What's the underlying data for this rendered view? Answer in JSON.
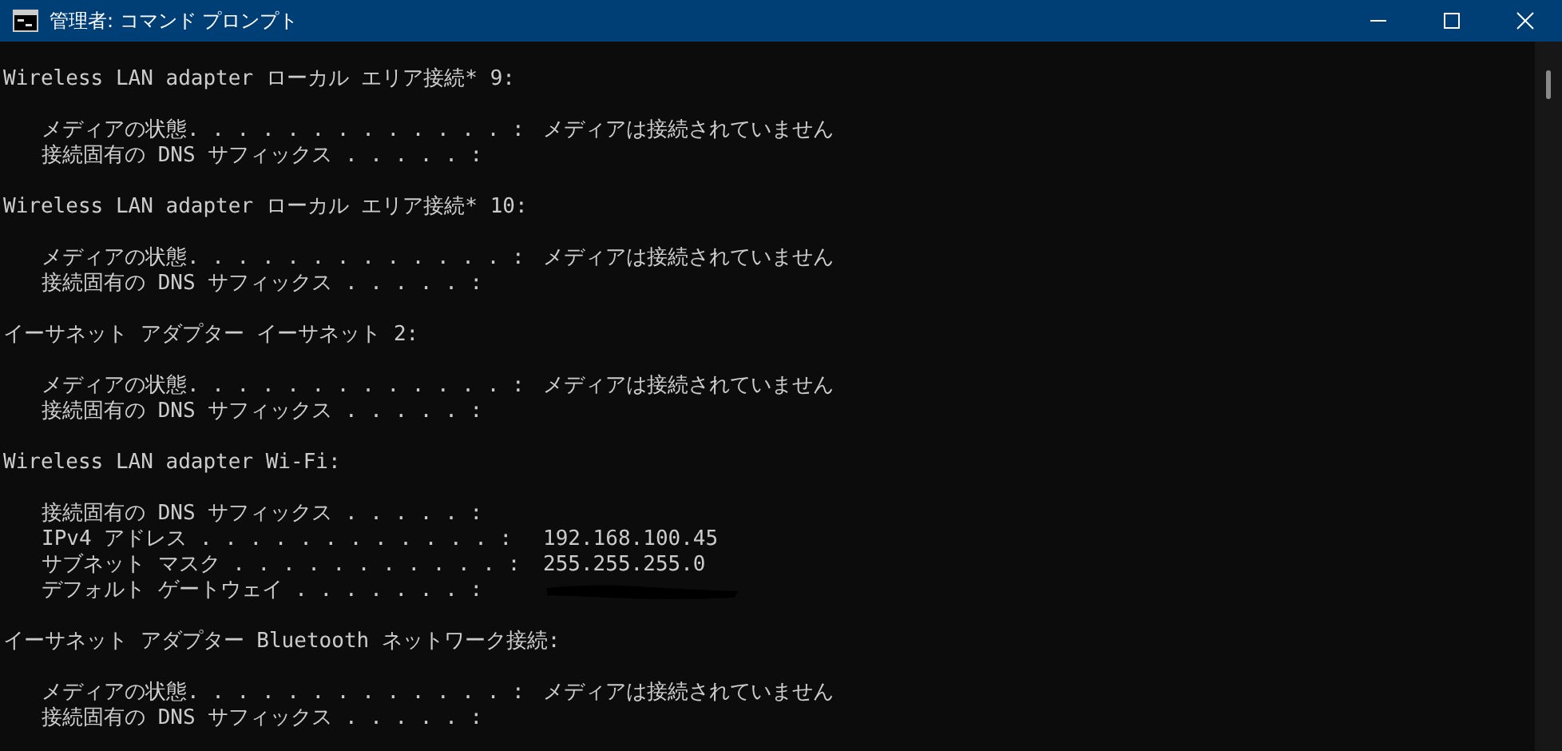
{
  "window": {
    "title": "管理者: コマンド プロンプト"
  },
  "sections": [
    {
      "header": "Wireless LAN adapter ローカル エリア接続* 9:",
      "entries": [
        {
          "label": "メディアの状態. . . . . . . . . . . . . :",
          "value": "メディアは接続されていません"
        },
        {
          "label": "接続固有の DNS サフィックス . . . . . :"
        }
      ]
    },
    {
      "header": "Wireless LAN adapter ローカル エリア接続* 10:",
      "entries": [
        {
          "label": "メディアの状態. . . . . . . . . . . . . :",
          "value": "メディアは接続されていません"
        },
        {
          "label": "接続固有の DNS サフィックス . . . . . :"
        }
      ]
    },
    {
      "header": "イーサネット アダプター イーサネット 2:",
      "entries": [
        {
          "label": "メディアの状態. . . . . . . . . . . . . :",
          "value": "メディアは接続されていません"
        },
        {
          "label": "接続固有の DNS サフィックス . . . . . :"
        }
      ]
    },
    {
      "header": "Wireless LAN adapter Wi-Fi:",
      "entries": [
        {
          "label": "接続固有の DNS サフィックス . . . . . :"
        },
        {
          "label": "IPv4 アドレス . . . . . . . . . . . . :",
          "value": "192.168.100.45"
        },
        {
          "label": "サブネット マスク . . . . . . . . . . . :",
          "value": "255.255.255.0"
        },
        {
          "label": "デフォルト ゲートウェイ . . . . . . . :",
          "redacted": true
        }
      ]
    },
    {
      "header": "イーサネット アダプター Bluetooth ネットワーク接続:",
      "entries": [
        {
          "label": "メディアの状態. . . . . . . . . . . . . :",
          "value": "メディアは接続されていません"
        },
        {
          "label": "接続固有の DNS サフィックス . . . . . :"
        }
      ]
    }
  ]
}
